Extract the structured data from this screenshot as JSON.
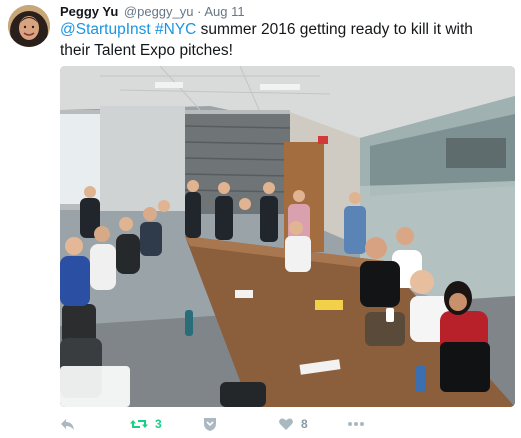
{
  "tweet": {
    "author_name": "Peggy Yu",
    "author_handle": "@peggy_yu",
    "separator": "·",
    "timestamp": "Aug 11",
    "text_parts": {
      "mention": "@StartupInst",
      "space": " ",
      "hashtag": "#NYC",
      "rest": " summer 2016 getting ready to kill it with their Talent Expo pitches!"
    },
    "media_icon": "photo-conference-room",
    "actions": {
      "reply_icon": "reply-icon",
      "retweet_icon": "retweet-icon",
      "retweet_count": "3",
      "save_icon": "bookmark-icon",
      "like_icon": "heart-icon",
      "like_count": "8",
      "more_icon": "more-icon"
    }
  },
  "colors": {
    "link": "#1b95e0",
    "retweet_active": "#19cf86",
    "icon_muted": "#aab8c2",
    "meta_text": "#657786"
  }
}
